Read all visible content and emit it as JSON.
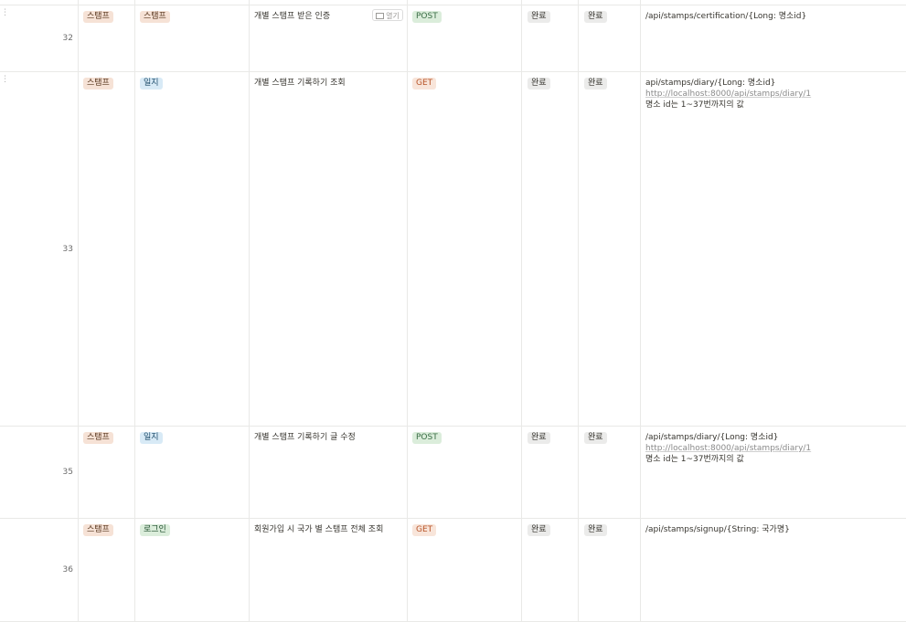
{
  "rows": [
    {
      "num": "32",
      "category": "스탬프",
      "subcategory": "스탬프",
      "description": "개별 스탬프 받은 인증",
      "open_label": "열기",
      "method": "POST",
      "status1": "완료",
      "status2": "완료",
      "endpoint": "/api/stamps/certification/{Long: 명소id}",
      "endpoint_link": "",
      "note": ""
    },
    {
      "num": "33",
      "category": "스탬프",
      "subcategory": "일지",
      "description": "개별 스탬프 기록하기 조회",
      "method": "GET",
      "status1": "완료",
      "status2": "완료",
      "endpoint": "api/stamps/diary/{Long: 명소id}",
      "endpoint_link": "http://localhost:8000/api/stamps/diary/1",
      "note": "명소 id는 1~37번까지의 값"
    },
    {
      "num": "35",
      "category": "스탬프",
      "subcategory": "일지",
      "description": "개별 스탬프 기록하기 글 수정",
      "method": "POST",
      "status1": "완료",
      "status2": "완료",
      "endpoint": "/api/stamps/diary/{Long: 명소id}",
      "endpoint_link": "http://localhost:8000/api/stamps/diary/1",
      "note": "명소 id는 1~37번까지의 값"
    },
    {
      "num": "36",
      "category": "스탬프",
      "subcategory": "로그인",
      "description": "회원가입 시 국가 별 스탬프 전체 조회",
      "method": "GET",
      "status1": "완료",
      "status2": "완료",
      "endpoint": "/api/stamps/signup/{String: 국가명}",
      "endpoint_link": "",
      "note": ""
    }
  ]
}
